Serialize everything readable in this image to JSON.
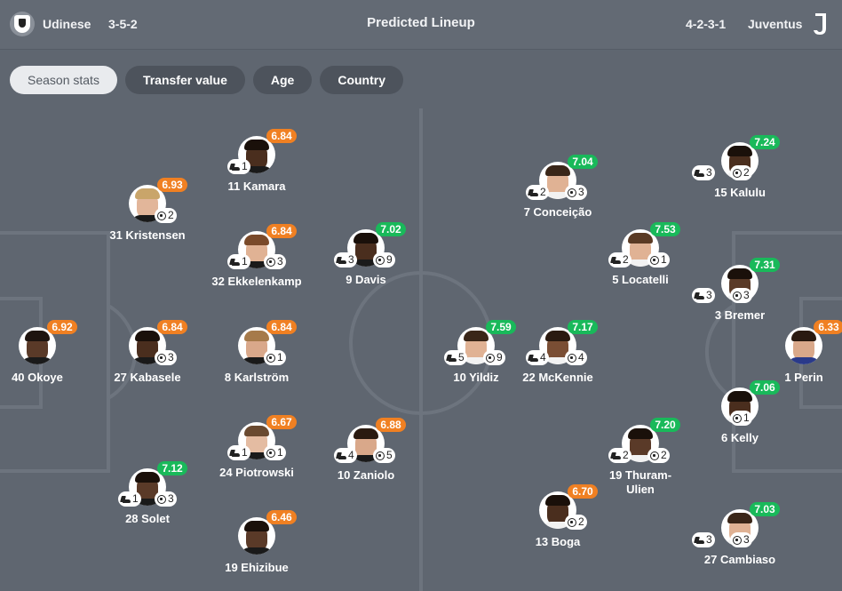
{
  "header": {
    "home_team": "Udinese",
    "home_formation": "3-5-2",
    "title": "Predicted Lineup",
    "away_formation": "4-2-3-1",
    "away_team": "Juventus",
    "home_logo_icon": "udinese-crest-icon",
    "away_logo_icon": "juventus-j-logo-icon"
  },
  "filters": [
    "Season stats",
    "Transfer value",
    "Age",
    "Country"
  ],
  "active_filter": "Season stats",
  "colors": {
    "pitch": "#5f6670",
    "rating_orange": "#f08022",
    "rating_green": "#19b95a",
    "active_pill": "#e9ebee",
    "pill": "#4d535c"
  },
  "players": {
    "okoye": {
      "name": "40 Okoye",
      "rating": "6.92",
      "rating_color": "orange"
    },
    "kristensen": {
      "name": "31 Kristensen",
      "rating": "6.93",
      "rating_color": "orange",
      "goals": "2"
    },
    "kabasele": {
      "name": "27 Kabasele",
      "rating": "6.84",
      "rating_color": "orange",
      "goals": "3"
    },
    "solet": {
      "name": "28 Solet",
      "rating": "7.12",
      "rating_color": "green",
      "assists": "1",
      "goals": "3"
    },
    "kamara": {
      "name": "11 Kamara",
      "rating": "6.84",
      "rating_color": "orange",
      "assists": "1"
    },
    "ekkelenkamp": {
      "name": "32 Ekkelenkamp",
      "rating": "6.84",
      "rating_color": "orange",
      "assists": "1",
      "goals": "3"
    },
    "karlstrom": {
      "name": "8 Karlström",
      "rating": "6.84",
      "rating_color": "orange",
      "goals": "1"
    },
    "piotrowski": {
      "name": "24 Piotrowski",
      "rating": "6.67",
      "rating_color": "orange",
      "assists": "1",
      "goals": "1"
    },
    "ehizibue": {
      "name": "19 Ehizibue",
      "rating": "6.46",
      "rating_color": "orange"
    },
    "davis": {
      "name": "9 Davis",
      "rating": "7.02",
      "rating_color": "green",
      "assists": "3",
      "goals": "9"
    },
    "zaniolo": {
      "name": "10 Zaniolo",
      "rating": "6.88",
      "rating_color": "orange",
      "assists": "4",
      "goals": "5"
    },
    "yildiz": {
      "name": "10 Yildiz",
      "rating": "7.59",
      "rating_color": "green",
      "assists": "5",
      "goals": "9"
    },
    "mckennie": {
      "name": "22 McKennie",
      "rating": "7.17",
      "rating_color": "green",
      "assists": "4",
      "goals": "4"
    },
    "conceicao": {
      "name": "7 Conceição",
      "rating": "7.04",
      "rating_color": "green",
      "assists": "2",
      "goals": "3"
    },
    "boga": {
      "name": "13 Boga",
      "rating": "6.70",
      "rating_color": "orange",
      "goals": "2"
    },
    "locatelli": {
      "name": "5 Locatelli",
      "rating": "7.53",
      "rating_color": "green",
      "assists": "2",
      "goals": "1"
    },
    "thuram": {
      "name": "19 Thuram-Ulien",
      "rating": "7.20",
      "rating_color": "green",
      "assists": "2",
      "goals": "2"
    },
    "kalulu": {
      "name": "15 Kalulu",
      "rating": "7.24",
      "rating_color": "green",
      "assists": "3",
      "goals": "2"
    },
    "bremer": {
      "name": "3 Bremer",
      "rating": "7.31",
      "rating_color": "green",
      "assists": "3",
      "goals": "3"
    },
    "kelly": {
      "name": "6 Kelly",
      "rating": "7.06",
      "rating_color": "green",
      "goals": "1"
    },
    "cambiaso": {
      "name": "27 Cambiaso",
      "rating": "7.03",
      "rating_color": "green",
      "assists": "3",
      "goals": "3"
    },
    "perin": {
      "name": "1 Perin",
      "rating": "6.33",
      "rating_color": "orange"
    }
  }
}
